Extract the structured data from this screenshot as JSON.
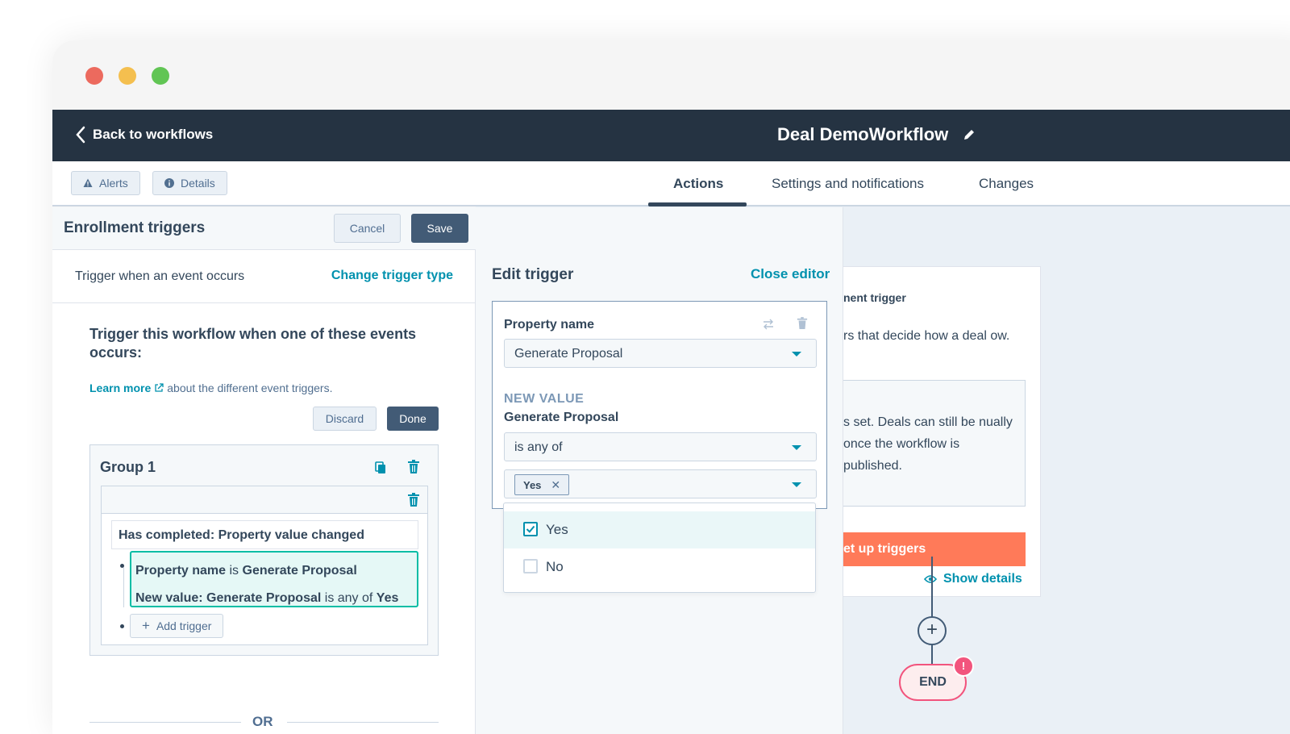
{
  "header": {
    "back_label": "Back to workflows",
    "workflow_title": "Deal DemoWorkflow"
  },
  "subbar": {
    "alerts_label": "Alerts",
    "details_label": "Details",
    "tabs": [
      "Actions",
      "Settings and notifications",
      "Changes"
    ]
  },
  "enrollment": {
    "title": "Enrollment triggers",
    "cancel_label": "Cancel",
    "save_label": "Save",
    "trigger_type_text": "Trigger when an event occurs",
    "change_trigger_type": "Change trigger type",
    "question": "Trigger this workflow when one of these events occurs:",
    "learn_more": "Learn more",
    "learn_more_suffix": "about the different event triggers.",
    "discard_label": "Discard",
    "done_label": "Done",
    "group_title": "Group 1",
    "condition": "Has completed: Property value changed",
    "filter_line1": {
      "a": "Property name",
      "b": " is ",
      "c": "Generate Proposal"
    },
    "filter_line2": {
      "a": "New value: Generate Proposal",
      "b": " is any of ",
      "c": "Yes"
    },
    "add_trigger": "Add trigger",
    "or_label": "OR"
  },
  "edit_trigger": {
    "title": "Edit trigger",
    "close_label": "Close editor",
    "property_name_label": "Property name",
    "property_value": "Generate Proposal",
    "new_value_label": "NEW VALUE",
    "new_value_property": "Generate Proposal",
    "operator": "is any of",
    "selected_tag": "Yes",
    "options": [
      {
        "label": "Yes",
        "checked": true
      },
      {
        "label": "No",
        "checked": false
      }
    ]
  },
  "workflow_card": {
    "heading": "nent trigger",
    "text": "rs that decide how a deal ow.",
    "info": "s set. Deals can still be nually once the workflow is published.",
    "setup_label": "et up triggers",
    "show_details": "Show details",
    "end_label": "END",
    "alert_badge": "!"
  },
  "colors": {
    "nav_bg": "#253342",
    "accent_link": "#0091ae",
    "primary_button": "#425b76",
    "setup_button": "#ff7a59",
    "filter_border": "#00bda5",
    "end_border": "#f2547d"
  }
}
